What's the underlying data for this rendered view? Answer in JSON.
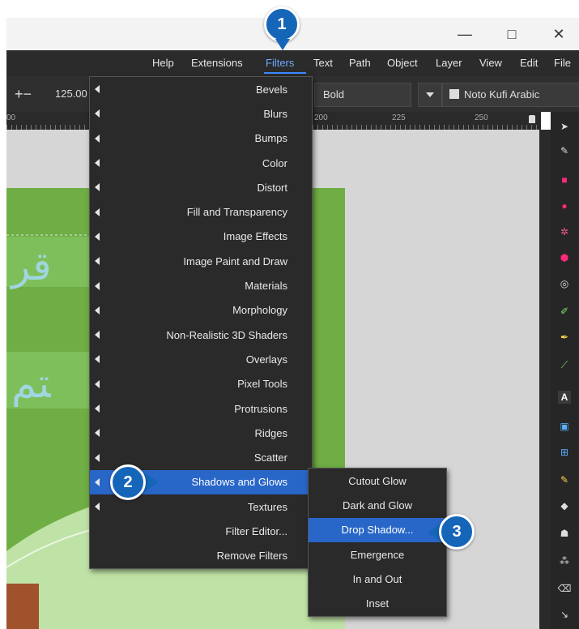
{
  "window": {
    "minimize_glyph": "—",
    "maximize_glyph": "□",
    "close_glyph": "✕"
  },
  "menubar": {
    "items": [
      "Help",
      "Extensions",
      "Filters",
      "Text",
      "Path",
      "Object",
      "Layer",
      "View",
      "Edit",
      "File"
    ],
    "active": "Filters"
  },
  "toolbar": {
    "zoom_symbols": "+−",
    "zoom_value": "125.00",
    "font_style": "Bold",
    "font_family": "Noto Kufi Arabic"
  },
  "ruler": {
    "labels": [
      "00",
      "200",
      "225",
      "250"
    ]
  },
  "filters_menu": {
    "items": [
      {
        "label": "Bevels",
        "submenu": true
      },
      {
        "label": "Blurs",
        "submenu": true
      },
      {
        "label": "Bumps",
        "submenu": true
      },
      {
        "label": "Color",
        "submenu": true
      },
      {
        "label": "Distort",
        "submenu": true
      },
      {
        "label": "Fill and Transparency",
        "submenu": true
      },
      {
        "label": "Image Effects",
        "submenu": true
      },
      {
        "label": "Image Paint and Draw",
        "submenu": true
      },
      {
        "label": "Materials",
        "submenu": true
      },
      {
        "label": "Morphology",
        "submenu": true
      },
      {
        "label": "Non-Realistic 3D Shaders",
        "submenu": true
      },
      {
        "label": "Overlays",
        "submenu": true
      },
      {
        "label": "Pixel Tools",
        "submenu": true
      },
      {
        "label": "Protrusions",
        "submenu": true
      },
      {
        "label": "Ridges",
        "submenu": true
      },
      {
        "label": "Scatter",
        "submenu": true
      },
      {
        "label": "Shadows and Glows",
        "submenu": true,
        "highlighted": true
      },
      {
        "label": "Textures",
        "submenu": true
      },
      {
        "label": "Filter Editor...",
        "submenu": false
      },
      {
        "label": "Remove Filters",
        "submenu": false
      }
    ]
  },
  "shadows_submenu": {
    "items": [
      {
        "label": "Cutout Glow"
      },
      {
        "label": "Dark and Glow"
      },
      {
        "label": "Drop Shadow...",
        "highlighted": true
      },
      {
        "label": "Emergence"
      },
      {
        "label": "In and Out"
      },
      {
        "label": "Inset"
      }
    ]
  },
  "callouts": [
    "1",
    "2",
    "3"
  ],
  "colors": {
    "highlight": "#2866c8",
    "callout": "#1565b8",
    "menu_bg": "#2a2a2a",
    "canvas_green": "#6fae44"
  }
}
